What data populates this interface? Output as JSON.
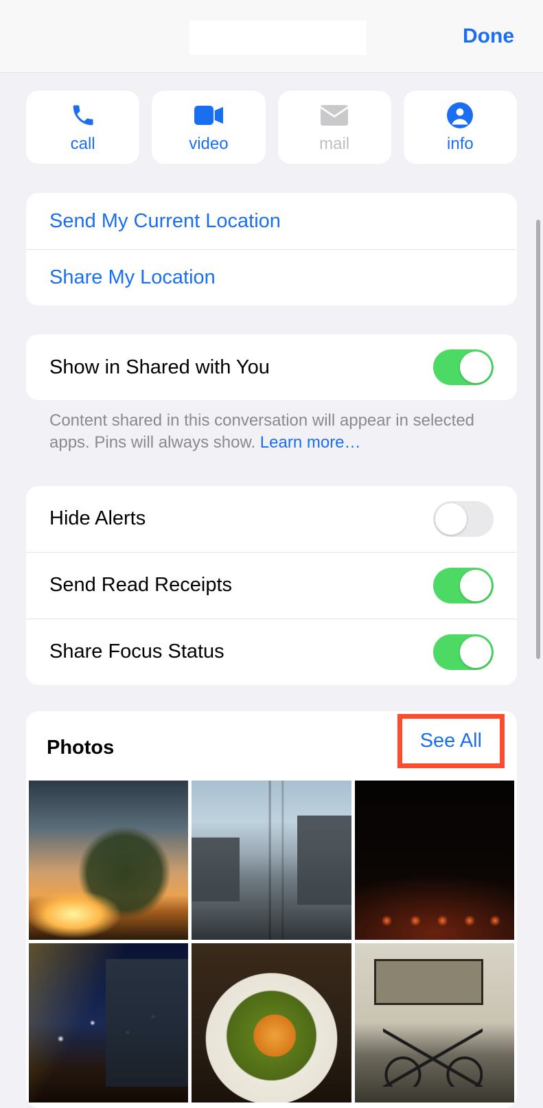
{
  "header": {
    "done_label": "Done"
  },
  "actions": {
    "call": {
      "label": "call",
      "enabled": true
    },
    "video": {
      "label": "video",
      "enabled": true
    },
    "mail": {
      "label": "mail",
      "enabled": false
    },
    "info": {
      "label": "info",
      "enabled": true
    }
  },
  "location": {
    "send_current": "Send My Current Location",
    "share": "Share My Location"
  },
  "shared_with_you": {
    "label": "Show in Shared with You",
    "on": true,
    "footnote_pre": "Content shared in this conversation will appear in selected apps. Pins will always show. ",
    "learn_more": "Learn more…"
  },
  "settings": {
    "hide_alerts": {
      "label": "Hide Alerts",
      "on": false
    },
    "read_receipts": {
      "label": "Send Read Receipts",
      "on": true
    },
    "share_focus_status": {
      "label": "Share Focus Status",
      "on": true
    }
  },
  "photos": {
    "title": "Photos",
    "see_all": "See All",
    "thumbs": [
      "sunset-tree",
      "city-street",
      "concert-stage",
      "night-buildings",
      "ramen-bowl",
      "bicycle-room"
    ]
  },
  "colors": {
    "accent": "#1a6ff1",
    "toggle_on": "#4cd964",
    "highlight_box": "#ff4b2e"
  }
}
